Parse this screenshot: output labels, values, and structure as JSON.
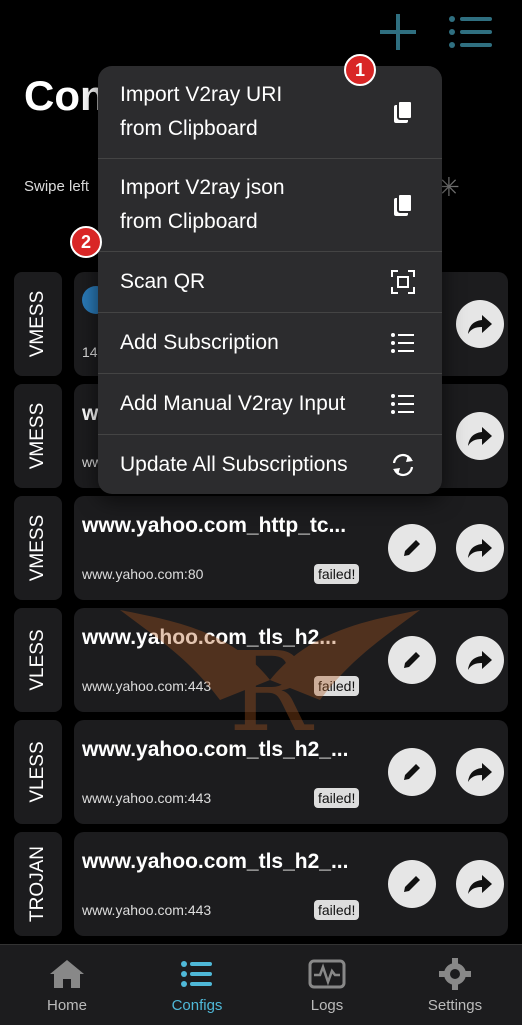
{
  "header": {
    "title": "Configs",
    "hint": "Swipe left"
  },
  "menu": {
    "items": [
      {
        "label_line1": "Import V2ray URI",
        "label_line2": "from Clipboard",
        "icon": "clipboard-icon"
      },
      {
        "label_line1": "Import V2ray json",
        "label_line2": "from Clipboard",
        "icon": "clipboard-icon"
      },
      {
        "label": "Scan QR",
        "icon": "qr-scan-icon"
      },
      {
        "label": "Add Subscription",
        "icon": "list-icon"
      },
      {
        "label": "Add Manual V2ray Input",
        "icon": "list-icon"
      },
      {
        "label": "Update All Subscriptions",
        "icon": "refresh-icon"
      }
    ]
  },
  "callouts": {
    "one": "1",
    "two": "2"
  },
  "configs": [
    {
      "protocol": "VMESS",
      "name": "",
      "host": "14",
      "status": ""
    },
    {
      "protocol": "VMESS",
      "name": "w",
      "host": "ww",
      "status": ""
    },
    {
      "protocol": "VMESS",
      "name": "www.yahoo.com_http_tc...",
      "host": "www.yahoo.com:80",
      "status": "failed!"
    },
    {
      "protocol": "VLESS",
      "name": "www.yahoo.com_tls_h2...",
      "host": "www.yahoo.com:443",
      "status": "failed!"
    },
    {
      "protocol": "VLESS",
      "name": "www.yahoo.com_tls_h2_...",
      "host": "www.yahoo.com:443",
      "status": "failed!"
    },
    {
      "protocol": "TROJAN",
      "name": "www.yahoo.com_tls_h2_...",
      "host": "www.yahoo.com:443",
      "status": "failed!"
    }
  ],
  "tabs": [
    {
      "label": "Home",
      "icon": "home-icon"
    },
    {
      "label": "Configs",
      "icon": "list-icon"
    },
    {
      "label": "Logs",
      "icon": "activity-icon"
    },
    {
      "label": "Settings",
      "icon": "gear-icon"
    }
  ],
  "colors": {
    "accent": "#4fb8d8",
    "callout": "#d92626",
    "background": "#000000",
    "card": "#1c1c1e"
  }
}
